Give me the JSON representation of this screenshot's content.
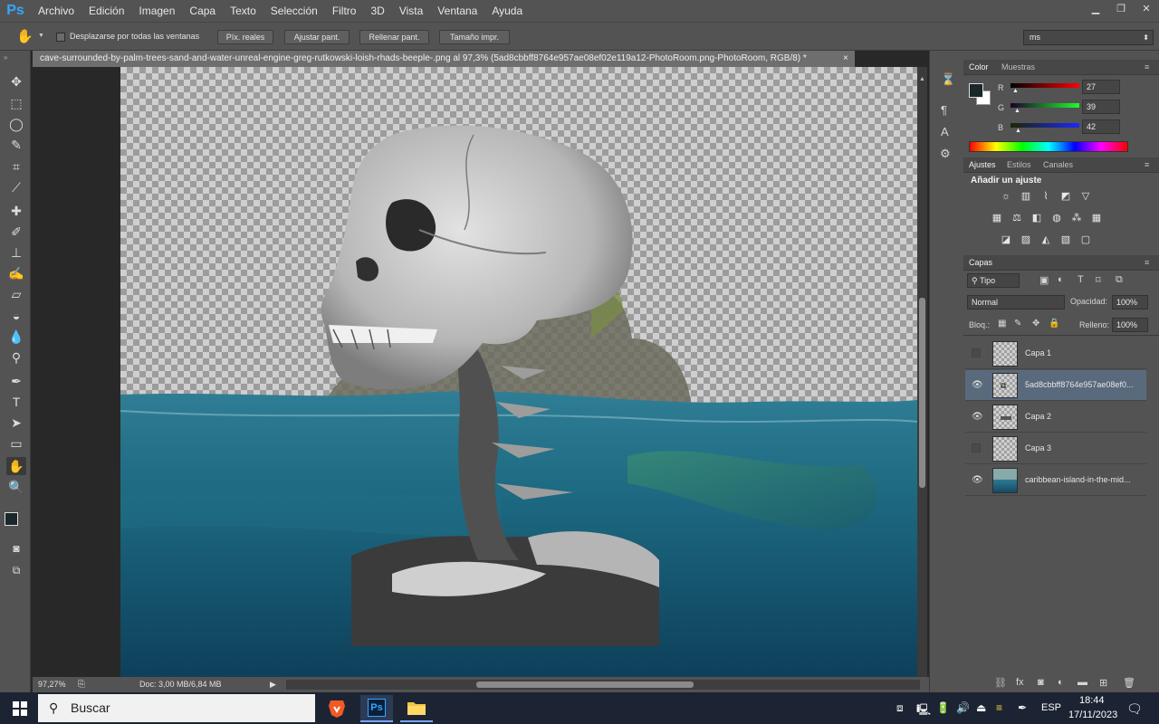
{
  "app": {
    "logo": "Ps"
  },
  "menu": [
    "Archivo",
    "Edición",
    "Imagen",
    "Capa",
    "Texto",
    "Selección",
    "Filtro",
    "3D",
    "Vista",
    "Ventana",
    "Ayuda"
  ],
  "window_controls": {
    "minimize": "▁",
    "restore": "❐",
    "close": "✕"
  },
  "options_bar": {
    "scroll_all_label": "Desplazarse por todas las ventanas",
    "buttons": [
      "Píx. reales",
      "Ajustar pant.",
      "Rellenar pant.",
      "Tamaño impr."
    ],
    "workspace": "ms"
  },
  "document": {
    "tab_title": "cave-surrounded-by-palm-trees-sand-and-water-unreal-engine-greg-rutkowski-loish-rhads-beeple-.png al 97,3% (5ad8cbbff8764e957ae08ef02e119a12-PhotoRoom.png-PhotoRoom, RGB/8) *",
    "tab_close": "×"
  },
  "status": {
    "zoom": "97,27%",
    "doc_size": "Doc: 3,00 MB/6,84 MB"
  },
  "color_panel": {
    "tabs": [
      "Color",
      "Muestras"
    ],
    "channels": [
      {
        "label": "R",
        "value": "27"
      },
      {
        "label": "G",
        "value": "39"
      },
      {
        "label": "B",
        "value": "42"
      }
    ],
    "foreground": "#1b272a",
    "slider_position": 0.11
  },
  "adjustments_panel": {
    "tabs": [
      "Ajustes",
      "Estilos",
      "Canales"
    ],
    "title": "Añadir un ajuste",
    "icons": [
      "brightness-icon",
      "levels-icon",
      "curves-icon",
      "exposure-icon",
      "vibrance-icon",
      "hue-saturation-icon",
      "color-balance-icon",
      "black-white-icon",
      "photo-filter-icon",
      "channel-mixer-icon",
      "color-lookup-icon",
      "invert-icon",
      "posterize-icon",
      "threshold-icon",
      "gradient-map-icon",
      "selective-color-icon"
    ]
  },
  "layers_panel": {
    "tab": "Capas",
    "filter_kind": "Tipo",
    "blend_mode": "Normal",
    "opacity_label": "Opacidad:",
    "opacity": "100%",
    "lock_label": "Bloq.:",
    "fill_label": "Relleno:",
    "fill": "100%",
    "layers": [
      {
        "name": "Capa 1",
        "visible": false,
        "selected": false
      },
      {
        "name": "5ad8cbbff8764e957ae08ef0...",
        "visible": true,
        "selected": true
      },
      {
        "name": "Capa 2",
        "visible": true,
        "selected": false
      },
      {
        "name": "Capa 3",
        "visible": false,
        "selected": false
      },
      {
        "name": "caribbean-island-in-the-mid...",
        "visible": true,
        "selected": false
      }
    ]
  },
  "taskbar": {
    "search_placeholder": "Buscar",
    "language": "ESP",
    "time": "18:44",
    "date": "17/11/2023"
  }
}
